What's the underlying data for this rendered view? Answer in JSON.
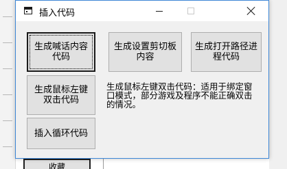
{
  "window": {
    "title": "插入代码"
  },
  "buttons": {
    "shout": "生成喊话内容代码",
    "clipboard": "生成设置剪切板内容",
    "open_path": "生成打开路径进程代码",
    "double_click": "生成鼠标左键双击代码",
    "loop": "插入循环代码"
  },
  "description": "生成鼠标左键双击代码：适用于绑定窗口模式，部分游戏及程序不能正确双击的情况。",
  "background": {
    "bottom_button_label": "收藏"
  },
  "colors": {
    "window_border": "#3c86d6",
    "button_face": "#e1e1e1",
    "dialog_face": "#f0f0f0"
  }
}
